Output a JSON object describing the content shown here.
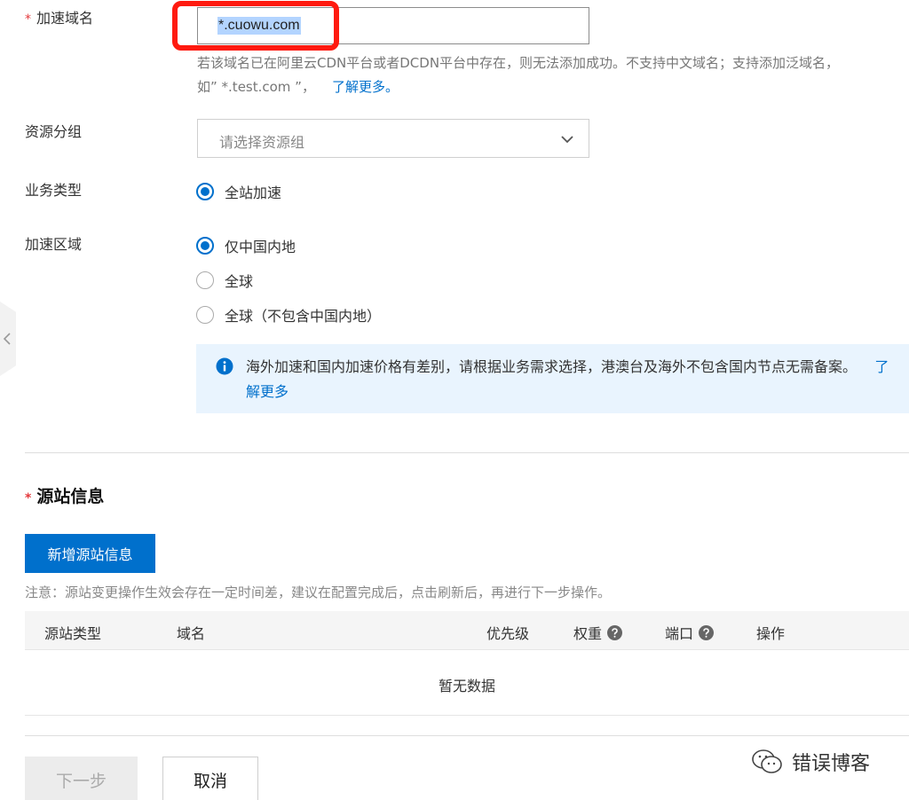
{
  "domain": {
    "label": "加速域名",
    "required_mark": "*",
    "value": "*.cuowu.com",
    "hint_line1": "若该域名已在阿里云CDN平台或者DCDN平台中存在，则无法添加成功。不支持中文域名；支持添加泛域名，",
    "hint_line2": "如” *.test.com ”，",
    "hint_link": "了解更多。"
  },
  "resource_group": {
    "label": "资源分组",
    "placeholder": "请选择资源组"
  },
  "business_type": {
    "label": "业务类型",
    "option": "全站加速"
  },
  "region": {
    "label": "加速区域",
    "options": [
      "仅中国内地",
      "全球",
      "全球（不包含中国内地）"
    ],
    "selected": 0,
    "info_text": "海外加速和国内加速价格有差别，请根据业务需求选择，港澳台及海外不包含国内节点无需备案。",
    "info_link": "了解更多"
  },
  "origin": {
    "required_mark": "*",
    "title": "源站信息",
    "add_button": "新增源站信息",
    "note": "注意：源站变更操作生效会存在一定时间差，建议在配置完成后，点击刷新后，再进行下一步操作。",
    "columns": [
      "源站类型",
      "域名",
      "优先级",
      "权重",
      "端口",
      "操作"
    ],
    "empty_text": "暂无数据"
  },
  "footer": {
    "next_button": "下一步",
    "cancel_button": "取消"
  },
  "watermark": {
    "text": "错误博客"
  },
  "colors": {
    "accent": "#0070cc",
    "highlight": "#ff1a0f",
    "info_bg": "#e9f4fe"
  }
}
